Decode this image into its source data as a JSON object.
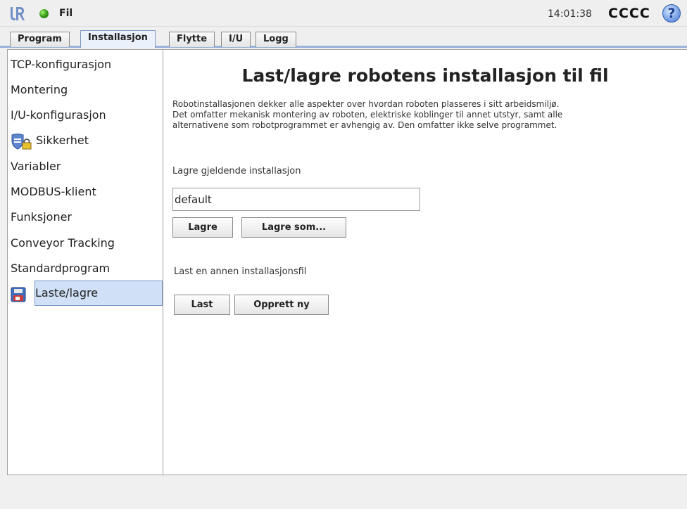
{
  "titlebar": {
    "menu_label": "Fil",
    "clock": "14:01:38",
    "robot_name": "CCCC",
    "help_label": "?",
    "logo_icon": "ur-logo-icon",
    "status_color": "#3aa51a"
  },
  "tabs": [
    {
      "label": "Program"
    },
    {
      "label": "Installasjon",
      "active": true
    },
    {
      "label": "Flytte"
    },
    {
      "label": "I/U"
    },
    {
      "label": "Logg"
    }
  ],
  "sidebar": {
    "items": [
      {
        "label": "TCP-konfigurasjon"
      },
      {
        "label": "Montering"
      },
      {
        "label": "I/U-konfigurasjon"
      },
      {
        "label": "Sikkerhet",
        "icon": "shield-lock-icon"
      },
      {
        "label": "Variabler"
      },
      {
        "label": "MODBUS-klient"
      },
      {
        "label": "Funksjoner"
      },
      {
        "label": "Conveyor Tracking"
      },
      {
        "label": "Standardprogram"
      },
      {
        "label": "Laste/lagre",
        "icon": "floppy-disk-icon",
        "selected": true
      }
    ]
  },
  "main": {
    "title": "Last/lagre robotens installasjon til fil",
    "description": [
      "Robotinstallasjonen dekker alle aspekter over hvordan roboten plasseres i sitt arbeidsmiljø.",
      "Det omfatter mekanisk montering av roboten, elektriske koblinger til annet utstyr, samt alle",
      "alternativene som robotprogrammet er avhengig av. Den omfatter ikke selve programmet."
    ],
    "save_section_label": "Lagre gjeldende installasjon",
    "filename_value": "default",
    "save_button": "Lagre",
    "save_as_button": "Lagre som...",
    "load_section_label": "Last en annen installasjonsfil",
    "load_button": "Last",
    "create_new_button": "Opprett ny"
  }
}
